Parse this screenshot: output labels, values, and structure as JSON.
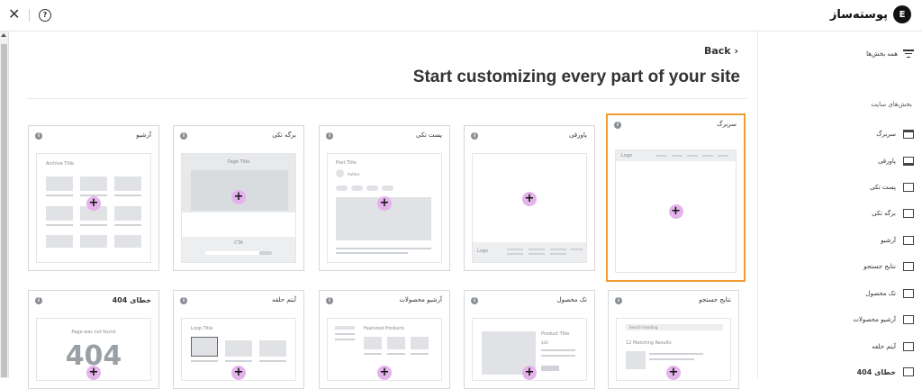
{
  "topbar": {
    "brand_label": "پوسته‌ساز",
    "brand_logo_text": "E",
    "close_icon": "close-icon",
    "help_icon": "help-icon"
  },
  "main": {
    "back_label": "Back ›",
    "title": "Start customizing every part of your site",
    "cards": [
      {
        "title": "سربرگ",
        "thumb": "header"
      },
      {
        "title": "پاورقی",
        "thumb": "footer"
      },
      {
        "title": "پست تکی",
        "thumb": "single-post"
      },
      {
        "title": "برگه تکی",
        "thumb": "single-page"
      },
      {
        "title": "آرشیو",
        "thumb": "archive"
      },
      {
        "title": "نتایج جستجو",
        "thumb": "search"
      },
      {
        "title": "تک محصول",
        "thumb": "product"
      },
      {
        "title": "آرشیو محصولات",
        "thumb": "product-archive"
      },
      {
        "title": "آیتم حلقه",
        "thumb": "loop-item"
      },
      {
        "title": "خطای 404",
        "thumb": "404"
      }
    ],
    "thumb_text": {
      "logo": "Logo",
      "archive_title": "Archive Title",
      "page_title": "Page Title",
      "cta": "CTA",
      "post_title": "Post Title",
      "author": "Author",
      "search_heading": "Search heading",
      "matching_results": "12 Matching Results",
      "product_title": "Product Title",
      "price": "$20",
      "featured_products": "Featured Products",
      "loop_title": "Loop Title",
      "not_found": "Page was not found",
      "code_404": "404"
    }
  },
  "panel": {
    "filter_label": "همه بخش‌ها",
    "heading": "بخش‌های سایت",
    "items": [
      {
        "label": "سربرگ"
      },
      {
        "label": "پاورقی"
      },
      {
        "label": "پست تکی"
      },
      {
        "label": "برگه تکی"
      },
      {
        "label": "آرشیو"
      },
      {
        "label": "نتایج جستجو"
      },
      {
        "label": "تک محصول"
      },
      {
        "label": "آرشیو محصولات"
      },
      {
        "label": "آیتم حلقه"
      },
      {
        "label": "خطای 404"
      }
    ]
  }
}
